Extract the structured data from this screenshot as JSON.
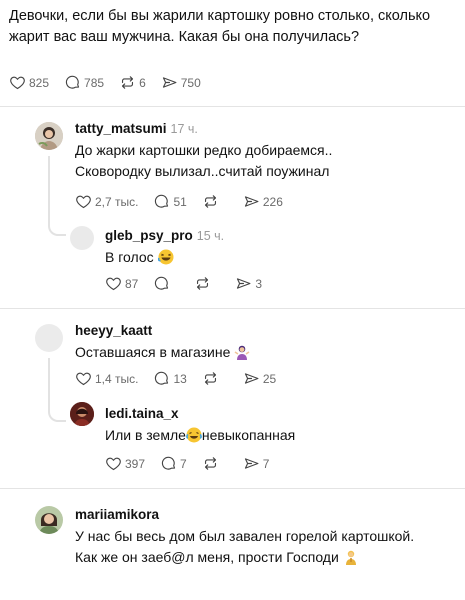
{
  "post": {
    "text": "Девочки, если бы вы жарили картошку ровно столько, сколько жарит вас ваш мужчина. Какая бы она получилась?",
    "likes": "825",
    "comments": "785",
    "reposts": "6",
    "shares": "750"
  },
  "comments": [
    {
      "username": "tatty_matsumi",
      "time": "17 ч.",
      "line1": "До жарки картошки редко добираемся..",
      "line2": "Сковородку вылизал..считай поужинал",
      "likes": "2,7 тыс.",
      "comments": "51",
      "reposts": "",
      "shares": "226",
      "reply": {
        "username": "gleb_psy_pro",
        "time": "15 ч.",
        "text": "В голос",
        "emoji": "laughing-face-emoji",
        "likes": "87",
        "comments": "",
        "reposts": "",
        "shares": "3"
      }
    },
    {
      "username": "heeyy_kaatt",
      "time": "",
      "text": "Оставшаяся в магазине",
      "emoji": "person-shrugging-emoji",
      "likes": "1,4 тыс.",
      "comments": "13",
      "reposts": "",
      "shares": "25",
      "reply": {
        "username": "ledi.taina_x",
        "time": "",
        "text_before": "Или в земле",
        "text_after": "невыкопанная",
        "emoji": "tears-of-joy-emoji",
        "likes": "397",
        "comments": "7",
        "reposts": "",
        "shares": "7"
      }
    },
    {
      "username": "mariiamikora",
      "time": "",
      "line1": "У нас бы весь дом был завален горелой картошкой.",
      "line2": "Как же он заеб@л меня, прости Господи",
      "emoji": "praying-person-emoji"
    }
  ]
}
